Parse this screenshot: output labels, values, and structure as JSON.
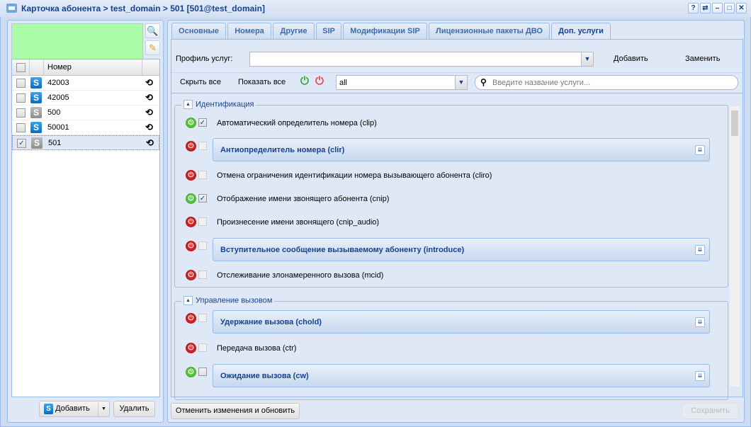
{
  "window": {
    "title": "Карточка абонента > test_domain > 501 [501@test_domain]",
    "tools": [
      "?",
      "⇄",
      "–",
      "□",
      "✕"
    ]
  },
  "left": {
    "grid_header": "Номер",
    "rows": [
      {
        "number": "42003",
        "type": "blue",
        "checked": false
      },
      {
        "number": "42005",
        "type": "blue",
        "checked": false
      },
      {
        "number": "500",
        "type": "gray",
        "checked": false
      },
      {
        "number": "50001",
        "type": "blue",
        "checked": false
      },
      {
        "number": "501",
        "type": "gray",
        "checked": true
      }
    ],
    "add_label": "Добавить",
    "delete_label": "Удалить"
  },
  "tabs": [
    "Основные",
    "Номера",
    "Другие",
    "SIP",
    "Модификации SIP",
    "Лицензионные пакеты ДВО",
    "Доп. услуги"
  ],
  "active_tab": "Доп. услуги",
  "profile": {
    "label": "Профиль услуг:",
    "value": "",
    "add": "Добавить",
    "replace": "Заменить"
  },
  "toolbar": {
    "hide_all": "Скрыть все",
    "show_all": "Показать все",
    "filter_value": "all",
    "search_placeholder": "Введите название услуги..."
  },
  "groups": [
    {
      "title": "Идентификация",
      "services": [
        {
          "name": "Автоматический определитель номера (clip)",
          "on": true,
          "checked": true,
          "panel": false
        },
        {
          "name": "Антиопределитель номера (clir)",
          "on": false,
          "checked": false,
          "panel": true
        },
        {
          "name": "Отмена ограничения идентификации номера вызывающего абонента (cliro)",
          "on": false,
          "checked": false,
          "panel": false
        },
        {
          "name": "Отображение имени звонящего абонента (cnip)",
          "on": true,
          "checked": true,
          "panel": false
        },
        {
          "name": "Произнесение имени звонящего (cnip_audio)",
          "on": false,
          "checked": false,
          "panel": false
        },
        {
          "name": "Вступительное сообщение вызываемому абоненту (introduce)",
          "on": false,
          "checked": false,
          "panel": true
        },
        {
          "name": "Отслеживание злонамеренного вызова (mcid)",
          "on": false,
          "checked": false,
          "panel": false
        }
      ]
    },
    {
      "title": "Управление вызовом",
      "services": [
        {
          "name": "Удержание вызова (chold)",
          "on": false,
          "checked": false,
          "panel": true
        },
        {
          "name": "Передача вызова (ctr)",
          "on": false,
          "checked": false,
          "panel": false
        },
        {
          "name": "Ожидание вызова (cw)",
          "on": true,
          "checked": false,
          "panel": true
        }
      ]
    }
  ],
  "footer": {
    "cancel": "Отменить изменения и обновить",
    "save": "Сохранить"
  }
}
